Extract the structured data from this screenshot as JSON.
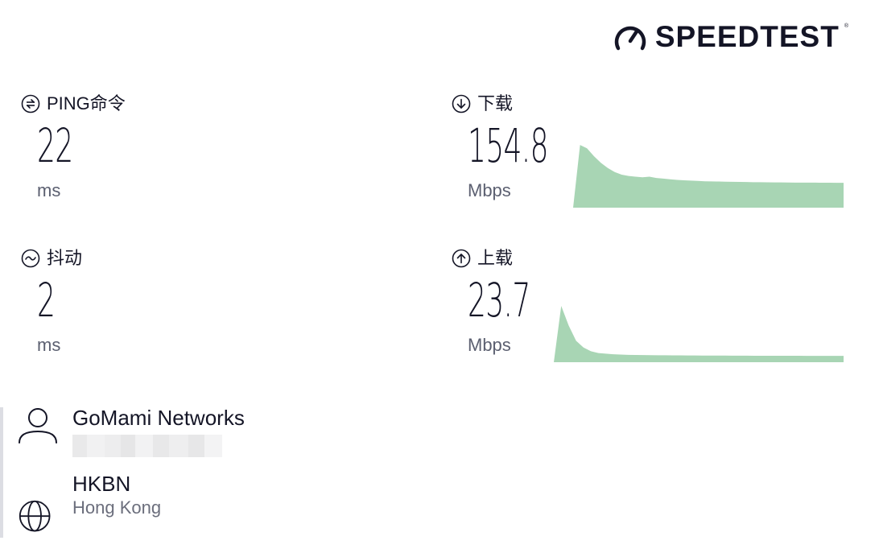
{
  "brand": {
    "name": "SPEEDTEST",
    "mark": "®"
  },
  "metrics": {
    "ping": {
      "label": "PING命令",
      "value": "22",
      "unit": "ms",
      "icon": "ping-icon"
    },
    "jitter": {
      "label": "抖动",
      "value": "2",
      "unit": "ms",
      "icon": "jitter-icon"
    },
    "download": {
      "label": "下载",
      "value": "154.8",
      "unit": "Mbps",
      "icon": "download-arrow-icon"
    },
    "upload": {
      "label": "上载",
      "value": "23.7",
      "unit": "Mbps",
      "icon": "upload-arrow-icon"
    }
  },
  "graphs": {
    "color": "#a8d5b4",
    "download_profile": [
      0.0,
      0.95,
      0.9,
      0.78,
      0.68,
      0.6,
      0.54,
      0.5,
      0.48,
      0.47,
      0.46,
      0.47,
      0.45,
      0.44,
      0.43,
      0.42,
      0.415,
      0.41,
      0.405,
      0.4,
      0.398,
      0.396,
      0.394,
      0.392,
      0.39,
      0.388,
      0.386,
      0.385,
      0.384,
      0.383,
      0.382,
      0.381,
      0.38,
      0.38,
      0.379,
      0.379,
      0.378,
      0.378,
      0.377,
      0.377
    ],
    "upload_profile": [
      0.0,
      0.92,
      0.6,
      0.35,
      0.24,
      0.18,
      0.15,
      0.14,
      0.13,
      0.125,
      0.12,
      0.118,
      0.116,
      0.115,
      0.114,
      0.113,
      0.112,
      0.111,
      0.11,
      0.11,
      0.109,
      0.109,
      0.108,
      0.108,
      0.107,
      0.107,
      0.107,
      0.106,
      0.106,
      0.106,
      0.105,
      0.105,
      0.105,
      0.105,
      0.104,
      0.104,
      0.104,
      0.104,
      0.103,
      0.103
    ]
  },
  "isp": {
    "name": "GoMami Networks",
    "icon": "user-icon"
  },
  "server": {
    "name": "HKBN",
    "location": "Hong Kong",
    "icon": "globe-icon"
  }
}
